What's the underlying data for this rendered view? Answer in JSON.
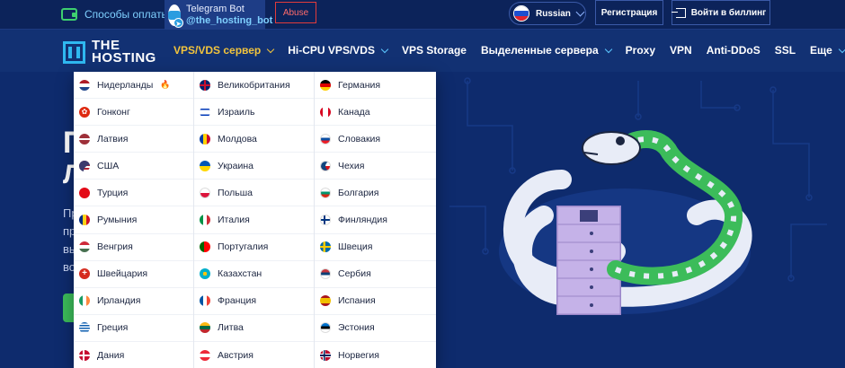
{
  "topbar": {
    "payments_label": "Способы оплаты",
    "telegram_title": "Telegram Bot",
    "telegram_handle": "@the_hosting_bot",
    "abuse_label": "Abuse",
    "language": "Russian",
    "register_label": "Регистрация",
    "billing_label": "Войти в биллинг"
  },
  "logo": {
    "line1": "THE",
    "line2": "HOSTING"
  },
  "nav": {
    "items": [
      {
        "label": "VPS/VDS сервер",
        "active": true,
        "dropdown": true
      },
      {
        "label": "Hi-CPU VPS/VDS",
        "dropdown": true
      },
      {
        "label": "VPS Storage",
        "dropdown": false
      },
      {
        "label": "Выделенные сервера",
        "dropdown": true
      },
      {
        "label": "Proxy",
        "dropdown": false
      },
      {
        "label": "VPN",
        "dropdown": false
      },
      {
        "label": "Anti-DDoS",
        "dropdown": false
      },
      {
        "label": "SSL",
        "dropdown": false
      },
      {
        "label": "Еще",
        "dropdown": true
      }
    ]
  },
  "hero": {
    "heading_fragment_1": "П",
    "heading_fragment_2": "Л",
    "para_fragments": [
      "Пр",
      "пр",
      "вы",
      "во"
    ]
  },
  "dropdown": {
    "columns": [
      [
        {
          "name": "Нидерланды",
          "flag": "nl",
          "hot": "🔥"
        },
        {
          "name": "Гонконг",
          "flag": "hk"
        },
        {
          "name": "Латвия",
          "flag": "lv"
        },
        {
          "name": "США",
          "flag": "us"
        },
        {
          "name": "Турция",
          "flag": "tr"
        },
        {
          "name": "Румыния",
          "flag": "ro"
        },
        {
          "name": "Венгрия",
          "flag": "hu"
        },
        {
          "name": "Швейцария",
          "flag": "ch"
        },
        {
          "name": "Ирландия",
          "flag": "ie"
        },
        {
          "name": "Греция",
          "flag": "gr"
        },
        {
          "name": "Дания",
          "flag": "dk"
        }
      ],
      [
        {
          "name": "Великобритания",
          "flag": "gb"
        },
        {
          "name": "Израиль",
          "flag": "il"
        },
        {
          "name": "Молдова",
          "flag": "md"
        },
        {
          "name": "Украина",
          "flag": "ua"
        },
        {
          "name": "Польша",
          "flag": "pl"
        },
        {
          "name": "Италия",
          "flag": "it"
        },
        {
          "name": "Португалия",
          "flag": "pt"
        },
        {
          "name": "Казахстан",
          "flag": "kz"
        },
        {
          "name": "Франция",
          "flag": "fr"
        },
        {
          "name": "Литва",
          "flag": "lt"
        },
        {
          "name": "Австрия",
          "flag": "at"
        }
      ],
      [
        {
          "name": "Германия",
          "flag": "de"
        },
        {
          "name": "Канада",
          "flag": "ca"
        },
        {
          "name": "Словакия",
          "flag": "sk"
        },
        {
          "name": "Чехия",
          "flag": "cz"
        },
        {
          "name": "Болгария",
          "flag": "bg"
        },
        {
          "name": "Финляндия",
          "flag": "fi"
        },
        {
          "name": "Швеция",
          "flag": "se"
        },
        {
          "name": "Сербия",
          "flag": "rs"
        },
        {
          "name": "Испания",
          "flag": "es"
        },
        {
          "name": "Эстония",
          "flag": "ee"
        },
        {
          "name": "Норвегия",
          "flag": "no"
        }
      ]
    ]
  },
  "colors": {
    "page_bg": "#0e2b6d",
    "topbar_bg": "#0c235a",
    "nav_bg": "#123173",
    "accent_yellow": "#f2c43d",
    "accent_cyan": "#2fb8f0",
    "snake_green": "#3cbc5a"
  }
}
